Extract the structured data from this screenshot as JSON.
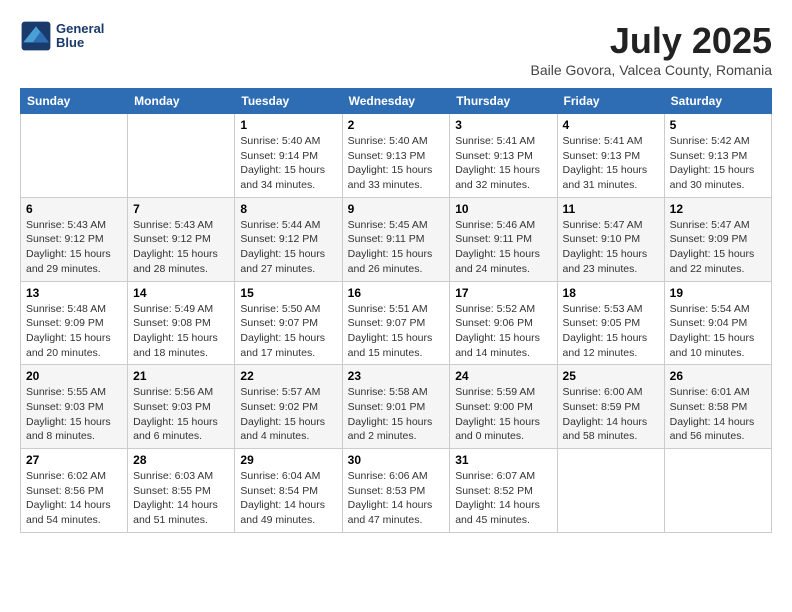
{
  "header": {
    "logo_line1": "General",
    "logo_line2": "Blue",
    "month_year": "July 2025",
    "location": "Baile Govora, Valcea County, Romania"
  },
  "days_of_week": [
    "Sunday",
    "Monday",
    "Tuesday",
    "Wednesday",
    "Thursday",
    "Friday",
    "Saturday"
  ],
  "weeks": [
    [
      {
        "day": "",
        "detail": ""
      },
      {
        "day": "",
        "detail": ""
      },
      {
        "day": "1",
        "detail": "Sunrise: 5:40 AM\nSunset: 9:14 PM\nDaylight: 15 hours and 34 minutes."
      },
      {
        "day": "2",
        "detail": "Sunrise: 5:40 AM\nSunset: 9:13 PM\nDaylight: 15 hours and 33 minutes."
      },
      {
        "day": "3",
        "detail": "Sunrise: 5:41 AM\nSunset: 9:13 PM\nDaylight: 15 hours and 32 minutes."
      },
      {
        "day": "4",
        "detail": "Sunrise: 5:41 AM\nSunset: 9:13 PM\nDaylight: 15 hours and 31 minutes."
      },
      {
        "day": "5",
        "detail": "Sunrise: 5:42 AM\nSunset: 9:13 PM\nDaylight: 15 hours and 30 minutes."
      }
    ],
    [
      {
        "day": "6",
        "detail": "Sunrise: 5:43 AM\nSunset: 9:12 PM\nDaylight: 15 hours and 29 minutes."
      },
      {
        "day": "7",
        "detail": "Sunrise: 5:43 AM\nSunset: 9:12 PM\nDaylight: 15 hours and 28 minutes."
      },
      {
        "day": "8",
        "detail": "Sunrise: 5:44 AM\nSunset: 9:12 PM\nDaylight: 15 hours and 27 minutes."
      },
      {
        "day": "9",
        "detail": "Sunrise: 5:45 AM\nSunset: 9:11 PM\nDaylight: 15 hours and 26 minutes."
      },
      {
        "day": "10",
        "detail": "Sunrise: 5:46 AM\nSunset: 9:11 PM\nDaylight: 15 hours and 24 minutes."
      },
      {
        "day": "11",
        "detail": "Sunrise: 5:47 AM\nSunset: 9:10 PM\nDaylight: 15 hours and 23 minutes."
      },
      {
        "day": "12",
        "detail": "Sunrise: 5:47 AM\nSunset: 9:09 PM\nDaylight: 15 hours and 22 minutes."
      }
    ],
    [
      {
        "day": "13",
        "detail": "Sunrise: 5:48 AM\nSunset: 9:09 PM\nDaylight: 15 hours and 20 minutes."
      },
      {
        "day": "14",
        "detail": "Sunrise: 5:49 AM\nSunset: 9:08 PM\nDaylight: 15 hours and 18 minutes."
      },
      {
        "day": "15",
        "detail": "Sunrise: 5:50 AM\nSunset: 9:07 PM\nDaylight: 15 hours and 17 minutes."
      },
      {
        "day": "16",
        "detail": "Sunrise: 5:51 AM\nSunset: 9:07 PM\nDaylight: 15 hours and 15 minutes."
      },
      {
        "day": "17",
        "detail": "Sunrise: 5:52 AM\nSunset: 9:06 PM\nDaylight: 15 hours and 14 minutes."
      },
      {
        "day": "18",
        "detail": "Sunrise: 5:53 AM\nSunset: 9:05 PM\nDaylight: 15 hours and 12 minutes."
      },
      {
        "day": "19",
        "detail": "Sunrise: 5:54 AM\nSunset: 9:04 PM\nDaylight: 15 hours and 10 minutes."
      }
    ],
    [
      {
        "day": "20",
        "detail": "Sunrise: 5:55 AM\nSunset: 9:03 PM\nDaylight: 15 hours and 8 minutes."
      },
      {
        "day": "21",
        "detail": "Sunrise: 5:56 AM\nSunset: 9:03 PM\nDaylight: 15 hours and 6 minutes."
      },
      {
        "day": "22",
        "detail": "Sunrise: 5:57 AM\nSunset: 9:02 PM\nDaylight: 15 hours and 4 minutes."
      },
      {
        "day": "23",
        "detail": "Sunrise: 5:58 AM\nSunset: 9:01 PM\nDaylight: 15 hours and 2 minutes."
      },
      {
        "day": "24",
        "detail": "Sunrise: 5:59 AM\nSunset: 9:00 PM\nDaylight: 15 hours and 0 minutes."
      },
      {
        "day": "25",
        "detail": "Sunrise: 6:00 AM\nSunset: 8:59 PM\nDaylight: 14 hours and 58 minutes."
      },
      {
        "day": "26",
        "detail": "Sunrise: 6:01 AM\nSunset: 8:58 PM\nDaylight: 14 hours and 56 minutes."
      }
    ],
    [
      {
        "day": "27",
        "detail": "Sunrise: 6:02 AM\nSunset: 8:56 PM\nDaylight: 14 hours and 54 minutes."
      },
      {
        "day": "28",
        "detail": "Sunrise: 6:03 AM\nSunset: 8:55 PM\nDaylight: 14 hours and 51 minutes."
      },
      {
        "day": "29",
        "detail": "Sunrise: 6:04 AM\nSunset: 8:54 PM\nDaylight: 14 hours and 49 minutes."
      },
      {
        "day": "30",
        "detail": "Sunrise: 6:06 AM\nSunset: 8:53 PM\nDaylight: 14 hours and 47 minutes."
      },
      {
        "day": "31",
        "detail": "Sunrise: 6:07 AM\nSunset: 8:52 PM\nDaylight: 14 hours and 45 minutes."
      },
      {
        "day": "",
        "detail": ""
      },
      {
        "day": "",
        "detail": ""
      }
    ]
  ]
}
